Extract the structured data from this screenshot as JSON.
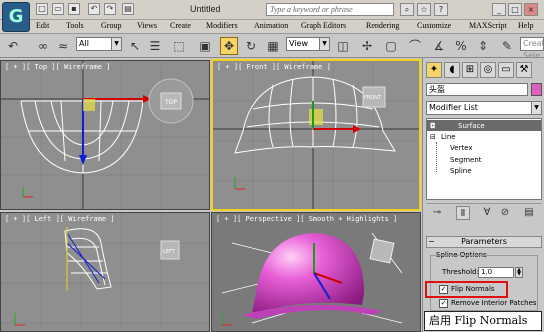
{
  "app": {
    "document_title": "Untitled",
    "search_placeholder": "Type a keyword or phrase",
    "logo_glyph": "G"
  },
  "menu": [
    "Edit",
    "Tools",
    "Group",
    "Views",
    "Create",
    "Modifiers",
    "Animation",
    "Graph Editors",
    "Rendering",
    "Customize",
    "MAXScript",
    "Help"
  ],
  "toolbar": {
    "selection_filter": "All",
    "reference_coord": "View",
    "create_selection_set": "Create Sele"
  },
  "viewports": {
    "top": {
      "label": "[ + ][ Top ][ Wireframe ]",
      "cube_text": "TOP"
    },
    "front": {
      "label": "[ + ][ Front ][ Wireframe ]",
      "cube_text": "FRONT"
    },
    "left": {
      "label": "[ + ][ Left ][ Wireframe ]",
      "cube_text": "LEFT"
    },
    "perspective": {
      "label": "[ + ][ Perspective ][ Smooth + Highlights ]"
    }
  },
  "command_panel": {
    "object_name": "头盔",
    "object_color": "#e060c0",
    "modifier_list": "Modifier List",
    "stack": {
      "surface": "Surface",
      "line": "Line",
      "vertex": "Vertex",
      "segment": "Segment",
      "spline": "Spline"
    },
    "rollout_title": "Parameters",
    "spline_options": "Spline Options",
    "threshold_label": "Threshold:",
    "threshold_value": "1.0",
    "flip_normals": "Flip Normals",
    "remove_interior": "Remove Interior Patches",
    "flip_checked_glyph": "✓",
    "remove_checked_glyph": "✓"
  },
  "callout": "启用 Flip Normals",
  "colors": {
    "active_viewport": "#f0d020",
    "highlight_box": "#e01010",
    "helmet": "#e050d0"
  }
}
